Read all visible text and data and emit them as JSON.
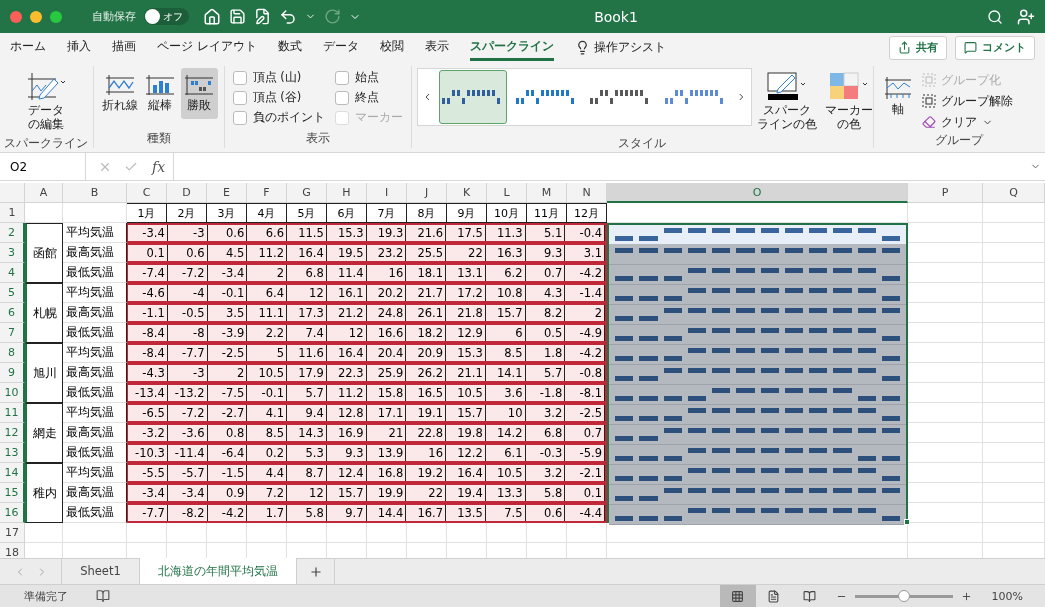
{
  "window": {
    "title": "Book1",
    "autosave_label": "自動保存",
    "autosave_toggle": "オフ",
    "autosave_on": false
  },
  "ribbon_tabs": [
    {
      "label": "ホーム",
      "selected": false
    },
    {
      "label": "挿入",
      "selected": false
    },
    {
      "label": "描画",
      "selected": false
    },
    {
      "label": "ページ レイアウト",
      "selected": false
    },
    {
      "label": "数式",
      "selected": false
    },
    {
      "label": "データ",
      "selected": false
    },
    {
      "label": "校閲",
      "selected": false
    },
    {
      "label": "表示",
      "selected": false
    },
    {
      "label": "スパークライン",
      "selected": true
    }
  ],
  "tell_me": "操作アシスト",
  "share_button": "共有",
  "comment_button": "コメント",
  "ribbon": {
    "sparkline_group": {
      "title": "スパークライン",
      "edit_data": [
        "データ",
        "の編集"
      ]
    },
    "type_group": {
      "title": "種類",
      "types": [
        {
          "label": "折れ線",
          "kind": "line",
          "selected": false
        },
        {
          "label": "縦棒",
          "kind": "column",
          "selected": false
        },
        {
          "label": "勝敗",
          "kind": "winloss",
          "selected": true
        }
      ]
    },
    "show_group": {
      "title": "表示",
      "options": [
        {
          "label": "頂点 (山)",
          "checked": false,
          "disabled": false
        },
        {
          "label": "頂点 (谷)",
          "checked": false,
          "disabled": false
        },
        {
          "label": "負のポイント",
          "checked": false,
          "disabled": false
        },
        {
          "label": "始点",
          "checked": false,
          "disabled": false
        },
        {
          "label": "終点",
          "checked": false,
          "disabled": false
        },
        {
          "label": "マーカー",
          "checked": false,
          "disabled": true
        }
      ]
    },
    "style_group": {
      "title": "スタイル",
      "styles": [
        {
          "color": "#2f5f9e",
          "selected": true
        },
        {
          "color": "#1f78c8",
          "selected": false
        },
        {
          "color": "#595959",
          "selected": false
        },
        {
          "color": "#5b8bd6",
          "selected": false
        }
      ],
      "sparkline_color": [
        "スパーク",
        "ラインの色"
      ],
      "marker_color": [
        "マーカー",
        "の色"
      ]
    },
    "group_group": {
      "title": "グループ",
      "axis": "軸",
      "commands": [
        {
          "label": "グループ化",
          "kind": "group",
          "disabled": true
        },
        {
          "label": "グループ解除",
          "kind": "ungroup",
          "disabled": false
        },
        {
          "label": "クリア",
          "kind": "clear",
          "disabled": false
        }
      ]
    }
  },
  "formula_bar": {
    "name_box": "O2",
    "fx": "fx"
  },
  "columns": [
    {
      "label": "A",
      "selected": false
    },
    {
      "label": "B",
      "selected": false
    },
    {
      "label": "C",
      "selected": false
    },
    {
      "label": "D",
      "selected": false
    },
    {
      "label": "E",
      "selected": false
    },
    {
      "label": "F",
      "selected": false
    },
    {
      "label": "G",
      "selected": false
    },
    {
      "label": "H",
      "selected": false
    },
    {
      "label": "I",
      "selected": false
    },
    {
      "label": "J",
      "selected": false
    },
    {
      "label": "K",
      "selected": false
    },
    {
      "label": "L",
      "selected": false
    },
    {
      "label": "M",
      "selected": false
    },
    {
      "label": "N",
      "selected": false
    },
    {
      "label": "O",
      "selected": true
    },
    {
      "label": "P",
      "selected": false
    },
    {
      "label": "Q",
      "selected": false
    }
  ],
  "row_numbers": [
    {
      "label": "1",
      "selected": false
    },
    {
      "label": "2",
      "selected": true
    },
    {
      "label": "3",
      "selected": true
    },
    {
      "label": "4",
      "selected": true
    },
    {
      "label": "5",
      "selected": true
    },
    {
      "label": "6",
      "selected": true
    },
    {
      "label": "7",
      "selected": true
    },
    {
      "label": "8",
      "selected": true
    },
    {
      "label": "9",
      "selected": true
    },
    {
      "label": "10",
      "selected": true
    },
    {
      "label": "11",
      "selected": true
    },
    {
      "label": "12",
      "selected": true
    },
    {
      "label": "13",
      "selected": true
    },
    {
      "label": "14",
      "selected": true
    },
    {
      "label": "15",
      "selected": true
    },
    {
      "label": "16",
      "selected": true
    },
    {
      "label": "17",
      "selected": false
    },
    {
      "label": "18",
      "selected": false
    }
  ],
  "months": [
    "1月",
    "2月",
    "3月",
    "4月",
    "5月",
    "6月",
    "7月",
    "8月",
    "9月",
    "10月",
    "11月",
    "12月"
  ],
  "cities": [
    {
      "name": "函館",
      "rows": [
        {
          "label": "平均気温",
          "active": true,
          "values": [
            "-3.4",
            "-3",
            "0.6",
            "6.6",
            "11.5",
            "15.3",
            "19.3",
            "21.6",
            "17.5",
            "11.3",
            "5.1",
            "-0.4"
          ]
        },
        {
          "label": "最高気温",
          "active": false,
          "values": [
            "0.1",
            "0.6",
            "4.5",
            "11.2",
            "16.4",
            "19.5",
            "23.2",
            "25.5",
            "22",
            "16.3",
            "9.3",
            "3.1"
          ]
        },
        {
          "label": "最低気温",
          "active": false,
          "values": [
            "-7.4",
            "-7.2",
            "-3.4",
            "2",
            "6.8",
            "11.4",
            "16",
            "18.1",
            "13.1",
            "6.2",
            "0.7",
            "-4.2"
          ]
        }
      ]
    },
    {
      "name": "札幌",
      "rows": [
        {
          "label": "平均気温",
          "active": false,
          "values": [
            "-4.6",
            "-4",
            "-0.1",
            "6.4",
            "12",
            "16.1",
            "20.2",
            "21.7",
            "17.2",
            "10.8",
            "4.3",
            "-1.4"
          ]
        },
        {
          "label": "最高気温",
          "active": false,
          "values": [
            "-1.1",
            "-0.5",
            "3.5",
            "11.1",
            "17.3",
            "21.2",
            "24.8",
            "26.1",
            "21.8",
            "15.7",
            "8.2",
            "2"
          ]
        },
        {
          "label": "最低気温",
          "active": false,
          "values": [
            "-8.4",
            "-8",
            "-3.9",
            "2.2",
            "7.4",
            "12",
            "16.6",
            "18.2",
            "12.9",
            "6",
            "0.5",
            "-4.9"
          ]
        }
      ]
    },
    {
      "name": "旭川",
      "rows": [
        {
          "label": "平均気温",
          "active": false,
          "values": [
            "-8.4",
            "-7.7",
            "-2.5",
            "5",
            "11.6",
            "16.4",
            "20.4",
            "20.9",
            "15.3",
            "8.5",
            "1.8",
            "-4.2"
          ]
        },
        {
          "label": "最高気温",
          "active": false,
          "values": [
            "-4.3",
            "-3",
            "2",
            "10.5",
            "17.9",
            "22.3",
            "25.9",
            "26.2",
            "21.1",
            "14.1",
            "5.7",
            "-0.8"
          ]
        },
        {
          "label": "最低気温",
          "active": false,
          "values": [
            "-13.4",
            "-13.2",
            "-7.5",
            "-0.1",
            "5.7",
            "11.2",
            "15.8",
            "16.5",
            "10.5",
            "3.6",
            "-1.8",
            "-8.1"
          ]
        }
      ]
    },
    {
      "name": "網走",
      "rows": [
        {
          "label": "平均気温",
          "active": false,
          "values": [
            "-6.5",
            "-7.2",
            "-2.7",
            "4.1",
            "9.4",
            "12.8",
            "17.1",
            "19.1",
            "15.7",
            "10",
            "3.2",
            "-2.5"
          ]
        },
        {
          "label": "最高気温",
          "active": false,
          "values": [
            "-3.2",
            "-3.6",
            "0.8",
            "8.5",
            "14.3",
            "16.9",
            "21",
            "22.8",
            "19.8",
            "14.2",
            "6.8",
            "0.7"
          ]
        },
        {
          "label": "最低気温",
          "active": false,
          "values": [
            "-10.3",
            "-11.4",
            "-6.4",
            "0.2",
            "5.3",
            "9.3",
            "13.9",
            "16",
            "12.2",
            "6.1",
            "-0.3",
            "-5.9"
          ]
        }
      ]
    },
    {
      "name": "稚内",
      "rows": [
        {
          "label": "平均気温",
          "active": false,
          "values": [
            "-5.5",
            "-5.7",
            "-1.5",
            "4.4",
            "8.7",
            "12.4",
            "16.8",
            "19.2",
            "16.4",
            "10.5",
            "3.2",
            "-2.1"
          ]
        },
        {
          "label": "最高気温",
          "active": false,
          "values": [
            "-3.4",
            "-3.4",
            "0.9",
            "7.2",
            "12",
            "15.7",
            "19.9",
            "22",
            "19.4",
            "13.3",
            "5.8",
            "0.1"
          ]
        },
        {
          "label": "最低気温",
          "active": false,
          "values": [
            "-7.7",
            "-8.2",
            "-4.2",
            "1.7",
            "5.8",
            "9.7",
            "14.4",
            "16.7",
            "13.5",
            "7.5",
            "0.6",
            "-4.4"
          ]
        }
      ]
    }
  ],
  "sheet_tabs": [
    {
      "label": "Sheet1",
      "selected": false
    },
    {
      "label": "北海道の年間平均気温",
      "selected": true
    }
  ],
  "status_bar": {
    "status": "準備完了",
    "zoom": "100%",
    "zoom_slider": {
      "level": 0.5
    }
  }
}
